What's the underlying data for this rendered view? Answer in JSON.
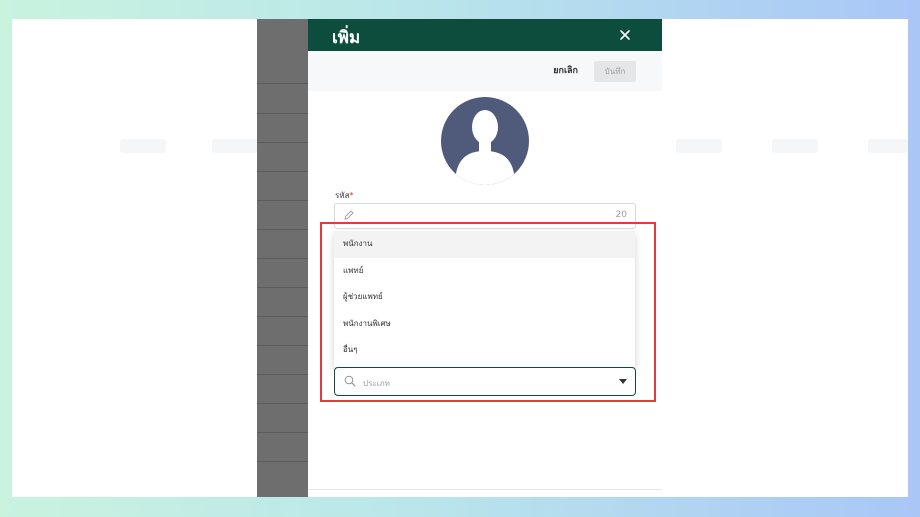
{
  "drawer": {
    "title": "เพิ่ม",
    "close_icon": "close-icon"
  },
  "toolbar": {
    "cancel_label": "ยกเลิก",
    "save_label": "บันทึก"
  },
  "form": {
    "avatar_icon": "user-avatar-icon",
    "code_label": "รหัส",
    "code_required_mark": "*",
    "code_icon": "pencil-icon",
    "code_counter": "20",
    "type_placeholder": "ประเภท",
    "type_search_icon": "search-icon",
    "type_caret_icon": "caret-down-icon"
  },
  "dropdown": {
    "options": [
      {
        "label": "พนักงาน",
        "active": true
      },
      {
        "label": "แพทย์",
        "active": false
      },
      {
        "label": "ผู้ช่วยแพทย์",
        "active": false
      },
      {
        "label": "พนักงานพิเศษ",
        "active": false
      },
      {
        "label": "อื่นๆ",
        "active": false
      }
    ]
  },
  "colors": {
    "header_bg": "#0d4d3d",
    "avatar_bg": "#505a7a",
    "highlight": "#e5393b",
    "required": "#e03030"
  }
}
